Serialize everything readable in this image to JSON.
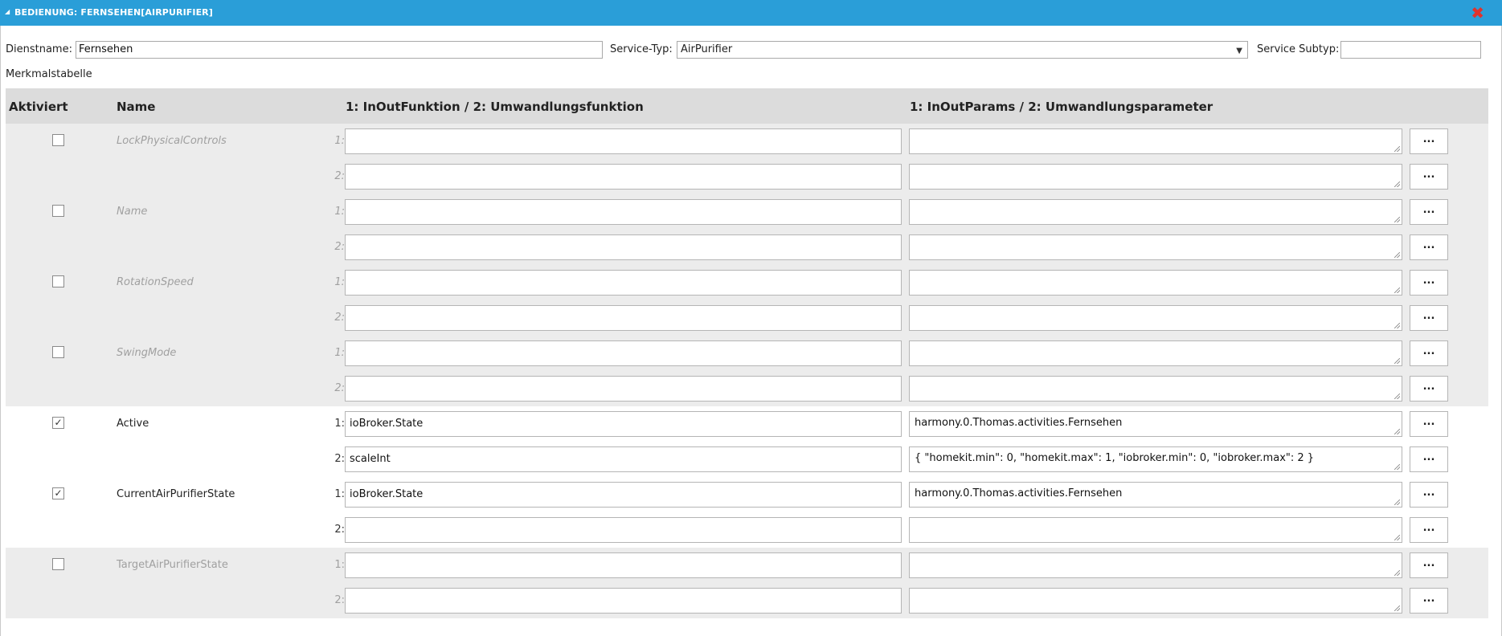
{
  "window": {
    "title": "BEDIENUNG: FERNSEHEN[AIRPURIFIER]"
  },
  "form": {
    "service_name_label": "Dienstname:",
    "service_name_value": "Fernsehen",
    "service_type_label": "Service-Typ:",
    "service_type_value": "AirPurifier",
    "service_subtype_label": "Service Subtyp:",
    "service_subtype_value": "",
    "table_title": "Merkmalstabelle"
  },
  "table": {
    "headers": {
      "active": "Aktiviert",
      "name": "Name",
      "function": "1: InOutFunktion / 2: Umwandlungsfunktion",
      "params": "1: InOutParams / 2: Umwandlungsparameter"
    },
    "row_labels": [
      "1:",
      "2:"
    ],
    "more_label": "...",
    "groups": [
      {
        "name": "LockPhysicalControls",
        "checked": "",
        "fn1": "",
        "par1": "",
        "fn2": "",
        "par2": ""
      },
      {
        "name": "Name",
        "checked": "",
        "fn1": "",
        "par1": "",
        "fn2": "",
        "par2": ""
      },
      {
        "name": "RotationSpeed",
        "checked": "",
        "fn1": "",
        "par1": "",
        "fn2": "",
        "par2": ""
      },
      {
        "name": "SwingMode",
        "checked": "",
        "fn1": "",
        "par1": "",
        "fn2": "",
        "par2": ""
      },
      {
        "name": "Active",
        "checked": "✓",
        "fn1": "ioBroker.State",
        "par1": "harmony.0.Thomas.activities.Fernsehen",
        "fn2": "scaleInt",
        "par2": "{ \"homekit.min\": 0, \"homekit.max\": 1, \"iobroker.min\": 0, \"iobroker.max\": 2 }"
      },
      {
        "name": "CurrentAirPurifierState",
        "checked": "✓",
        "fn1": "ioBroker.State",
        "par1": "harmony.0.Thomas.activities.Fernsehen",
        "fn2": "",
        "par2": ""
      },
      {
        "name": "TargetAirPurifierState",
        "checked": "",
        "fn1": "",
        "par1": "",
        "fn2": "",
        "par2": ""
      }
    ]
  }
}
